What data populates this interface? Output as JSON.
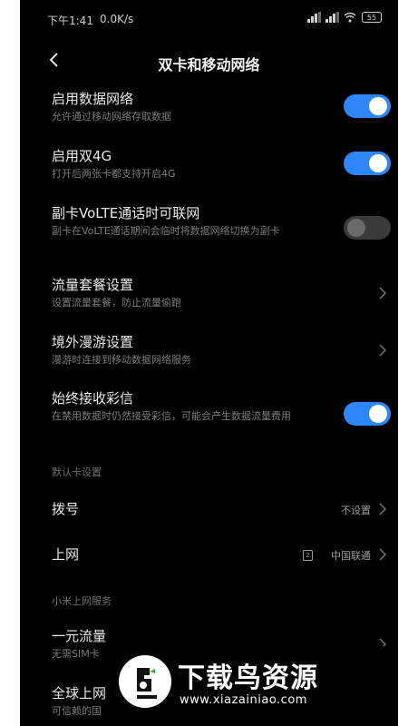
{
  "status_bar": {
    "time": "下午1:41",
    "net_speed": "0.0K/s",
    "battery": "55"
  },
  "header": {
    "title": "双卡和移动网络"
  },
  "settings": [
    {
      "title": "启用数据网络",
      "subtitle": "允许通过移动网络存取数据",
      "toggle": "on"
    },
    {
      "title": "启用双4G",
      "subtitle": "打开后两张卡都支持开启4G",
      "toggle": "on"
    },
    {
      "title": "副卡VoLTE通话时可联网",
      "subtitle": "副卡在VoLTE通话期间会临时将数据网络切换为副卡",
      "toggle": "off"
    },
    {
      "title": "流量套餐设置",
      "subtitle": "设置流量套餐，防止流量偷跑"
    },
    {
      "title": "境外漫游设置",
      "subtitle": "漫游时连接到移动数据网络服务"
    },
    {
      "title": "始终接收彩信",
      "subtitle": "在禁用数据时仍然接受彩信，可能会产生数据流量费用",
      "toggle": "on"
    }
  ],
  "default_card": {
    "section_label": "默认卡设置",
    "dial": {
      "title": "拨号",
      "value": "不设置"
    },
    "internet": {
      "title": "上网",
      "sim": "2",
      "value": "中国联通"
    }
  },
  "mi_service": {
    "section_label": "小米上网服务",
    "yuan_traffic": {
      "title": "一元流量",
      "subtitle": "无需SIM卡"
    },
    "global": {
      "title": "全球上网",
      "subtitle": "可信赖的国"
    }
  },
  "watermark": {
    "text": "下载鸟资源",
    "url": "www.xiazainiao.com"
  }
}
